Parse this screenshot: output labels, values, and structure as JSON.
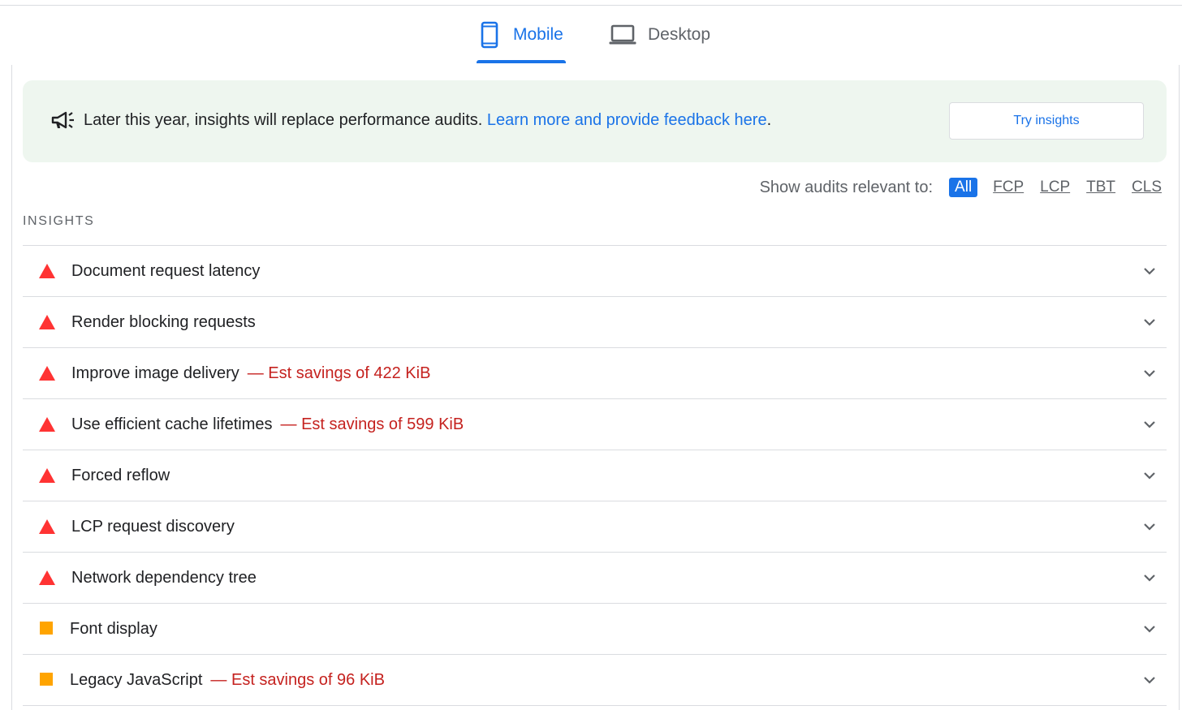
{
  "tabs": [
    {
      "label": "Mobile",
      "icon": "phone-icon",
      "active": true
    },
    {
      "label": "Desktop",
      "icon": "laptop-icon",
      "active": false
    }
  ],
  "banner": {
    "icon": "megaphone-icon",
    "message": "Later this year, insights will replace performance audits.",
    "link_text": "Learn more and provide feedback here",
    "trailing": ".",
    "button_label": "Try insights"
  },
  "filter": {
    "label": "Show audits relevant to:",
    "options": [
      "All",
      "FCP",
      "LCP",
      "TBT",
      "CLS"
    ],
    "selected": "All"
  },
  "insights": {
    "heading": "INSIGHTS",
    "items": [
      {
        "title": "Document request latency",
        "savings": "",
        "severity": "fail"
      },
      {
        "title": "Render blocking requests",
        "savings": "",
        "severity": "fail"
      },
      {
        "title": "Improve image delivery",
        "savings": "— Est savings of 422 KiB",
        "severity": "fail"
      },
      {
        "title": "Use efficient cache lifetimes",
        "savings": "— Est savings of 599 KiB",
        "severity": "fail"
      },
      {
        "title": "Forced reflow",
        "savings": "",
        "severity": "fail"
      },
      {
        "title": "LCP request discovery",
        "savings": "",
        "severity": "fail"
      },
      {
        "title": "Network dependency tree",
        "savings": "",
        "severity": "fail"
      },
      {
        "title": "Font display",
        "savings": "",
        "severity": "average"
      },
      {
        "title": "Legacy JavaScript",
        "savings": "— Est savings of 96 KiB",
        "severity": "average"
      }
    ]
  },
  "colors": {
    "accent": "#1a73e8",
    "fail": "#ff3333",
    "average": "#ffa400",
    "savings": "#c5221f",
    "banner_bg": "#eef6ef"
  }
}
